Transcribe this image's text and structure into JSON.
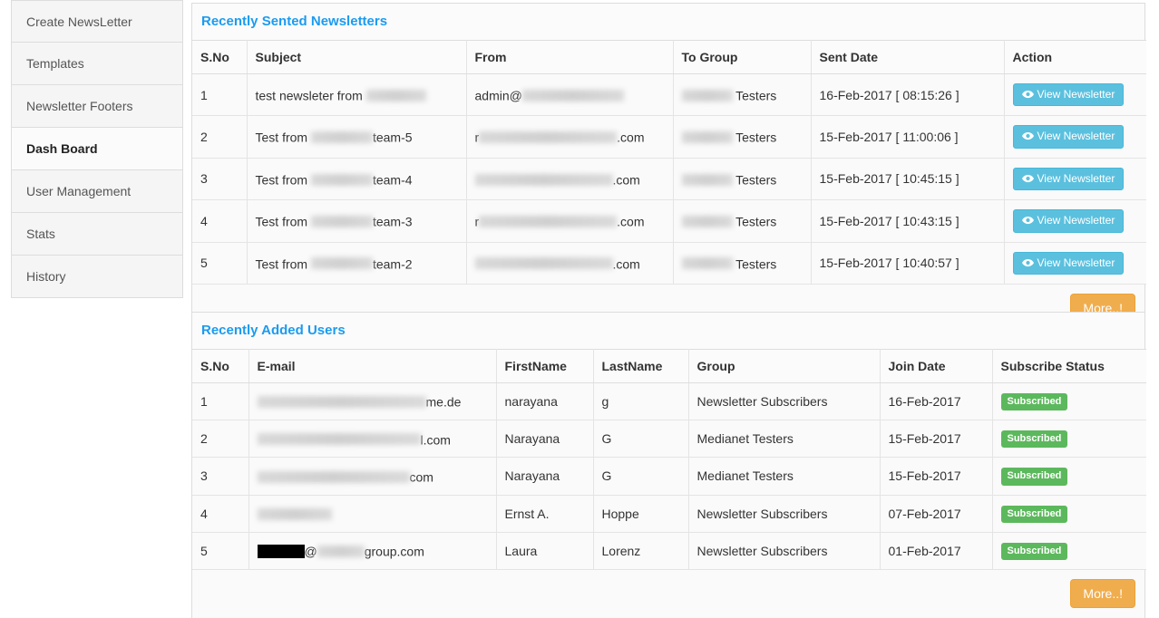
{
  "sidebar": {
    "items": [
      {
        "label": "Create NewsLetter",
        "active": false
      },
      {
        "label": "Templates",
        "active": false
      },
      {
        "label": "Newsletter Footers",
        "active": false
      },
      {
        "label": "Dash Board",
        "active": true
      },
      {
        "label": "User Management",
        "active": false
      },
      {
        "label": "Stats",
        "active": false
      },
      {
        "label": "History",
        "active": false
      }
    ]
  },
  "newsletters_panel": {
    "title": "Recently Sented Newsletters",
    "columns": [
      "S.No",
      "Subject",
      "From",
      "To Group",
      "Sent Date",
      "Action"
    ],
    "more_label": "More..!",
    "action_label": "View Newsletter",
    "action_icon": "eye-icon",
    "rows": [
      {
        "sno": "1",
        "subject_prefix": "test newsleter from ",
        "subject_redacted": true,
        "subject_suffix": "",
        "from_prefix": "admin@",
        "from_redacted": true,
        "from_suffix": "",
        "group_prefix": "",
        "group_redacted": true,
        "group_suffix": " Testers",
        "sent_date": "16-Feb-2017 [ 08:15:26 ]"
      },
      {
        "sno": "2",
        "subject_prefix": "Test from ",
        "subject_redacted": true,
        "subject_suffix": "team-5",
        "from_prefix": "r",
        "from_redacted": true,
        "from_suffix": ".com",
        "group_prefix": "",
        "group_redacted": true,
        "group_suffix": " Testers",
        "sent_date": "15-Feb-2017 [ 11:00:06 ]"
      },
      {
        "sno": "3",
        "subject_prefix": "Test from ",
        "subject_redacted": true,
        "subject_suffix": "team-4",
        "from_prefix": "",
        "from_redacted": true,
        "from_suffix": ".com",
        "group_prefix": "",
        "group_redacted": true,
        "group_suffix": " Testers",
        "sent_date": "15-Feb-2017 [ 10:45:15 ]"
      },
      {
        "sno": "4",
        "subject_prefix": "Test from ",
        "subject_redacted": true,
        "subject_suffix": "team-3",
        "from_prefix": "r",
        "from_redacted": true,
        "from_suffix": ".com",
        "group_prefix": "",
        "group_redacted": true,
        "group_suffix": " Testers",
        "sent_date": "15-Feb-2017 [ 10:43:15 ]"
      },
      {
        "sno": "5",
        "subject_prefix": "Test from ",
        "subject_redacted": true,
        "subject_suffix": "team-2",
        "from_prefix": "",
        "from_redacted": true,
        "from_suffix": ".com",
        "group_prefix": "",
        "group_redacted": true,
        "group_suffix": " Testers",
        "sent_date": "15-Feb-2017 [ 10:40:57 ]"
      }
    ]
  },
  "users_panel": {
    "title": "Recently Added Users",
    "columns": [
      "S.No",
      "E-mail",
      "FirstName",
      "LastName",
      "Group",
      "Join Date",
      "Subscribe Status"
    ],
    "more_label": "More..!",
    "status_label": "Subscribed",
    "rows": [
      {
        "sno": "1",
        "email_prefix": "",
        "email_redacted": true,
        "email_suffix": "me.de",
        "first_name": "narayana",
        "last_name": "g",
        "group": "Newsletter Subscribers",
        "join_date": "16-Feb-2017",
        "status": "Subscribed"
      },
      {
        "sno": "2",
        "email_prefix": "",
        "email_redacted": true,
        "email_suffix": "l.com",
        "first_name": "Narayana",
        "last_name": "G",
        "group": "Medianet Testers",
        "join_date": "15-Feb-2017",
        "status": "Subscribed"
      },
      {
        "sno": "3",
        "email_prefix": "",
        "email_redacted": true,
        "email_suffix": "com",
        "first_name": "Narayana",
        "last_name": "G",
        "group": "Medianet Testers",
        "join_date": "15-Feb-2017",
        "status": "Subscribed"
      },
      {
        "sno": "4",
        "email_prefix": "",
        "email_redacted": true,
        "email_suffix": "",
        "first_name": "Ernst A.",
        "last_name": "Hoppe",
        "group": "Newsletter Subscribers",
        "join_date": "07-Feb-2017",
        "status": "Subscribed"
      },
      {
        "sno": "5",
        "email_prefix": "",
        "email_redacted": true,
        "email_suffix": "group.com",
        "email_mid": "@",
        "first_name": "Laura",
        "last_name": "Lorenz",
        "group": "Newsletter Subscribers",
        "join_date": "01-Feb-2017",
        "status": "Subscribed"
      }
    ]
  },
  "colors": {
    "panel_title": "#1b9bf0",
    "more_button": "#f0ad4e",
    "view_button": "#5bc0de",
    "subscribed_badge": "#5cb85c"
  }
}
